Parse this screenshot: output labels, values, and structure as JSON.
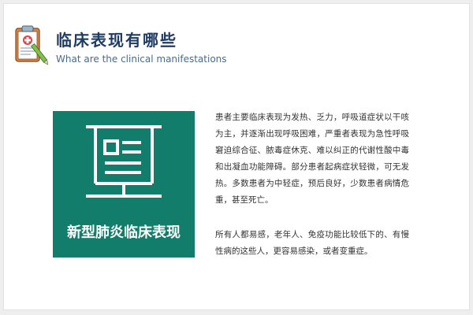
{
  "header": {
    "title": "临床表现有哪些",
    "subtitle": "What are the clinical manifestations",
    "icon": "clipboard-medical-icon"
  },
  "panel": {
    "label": "新型肺炎临床表现",
    "icon": "presentation-board-icon",
    "background_color": "#137d6b"
  },
  "content": {
    "paragraph_1": "患者主要临床表现为发热、乏力，呼吸道症状以干咳为主，并逐渐出现呼吸困难，严重者表现为急性呼吸窘迫综合征、脓毒症休克、难以纠正的代谢性酸中毒和出凝血功能障碍。部分患者起病症状轻微，可无发热。多数患者为中轻症，预后良好，少数患者病情危重，甚至死亡。",
    "paragraph_2": "所有人都易感，老年人、免疫功能比较低下的、有慢性病的这些人，更容易感染，或者变重症。"
  }
}
